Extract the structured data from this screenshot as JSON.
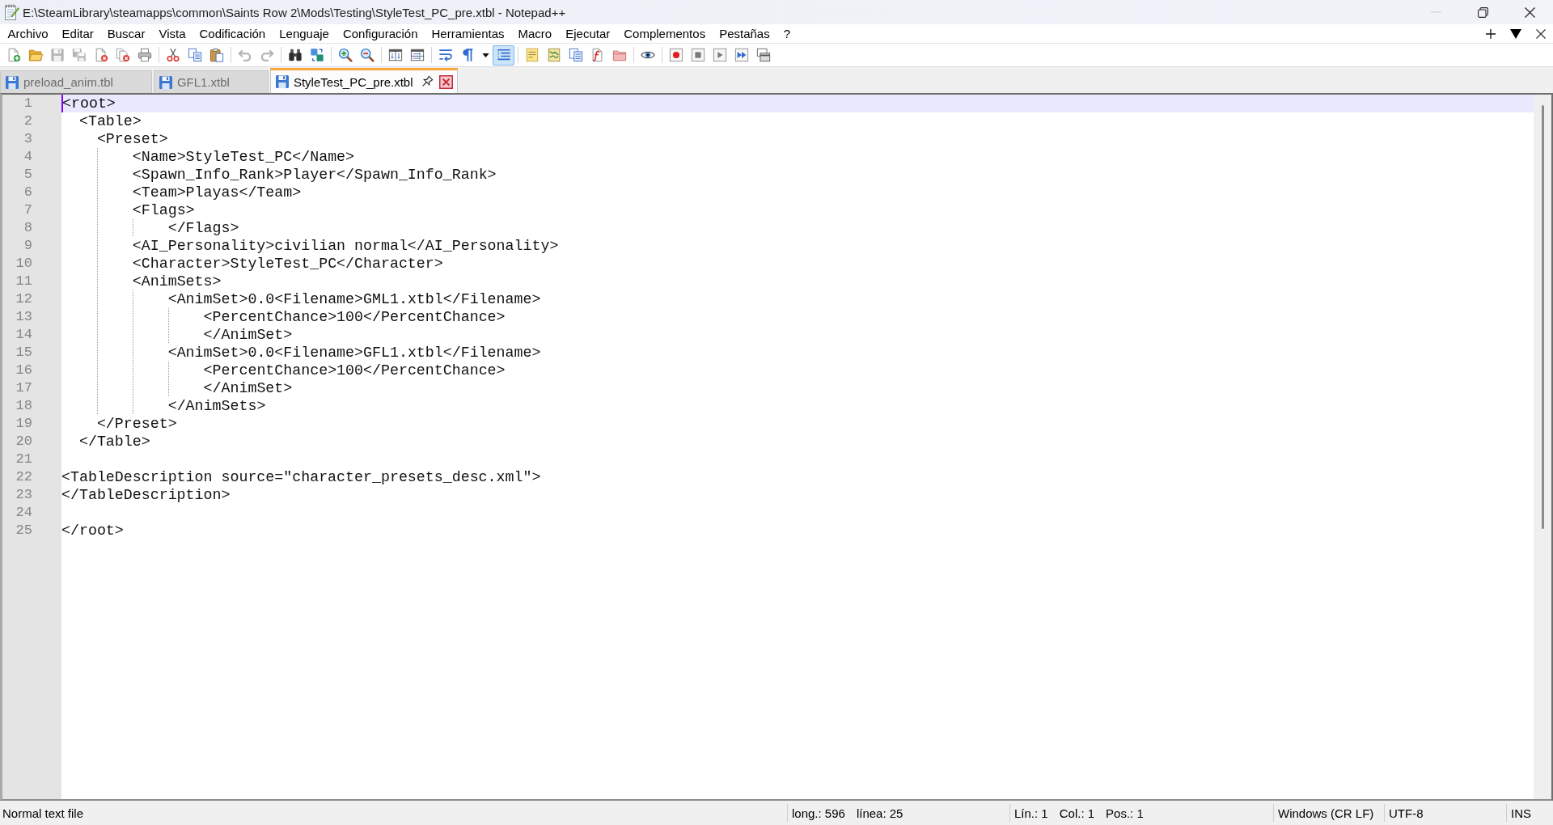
{
  "window": {
    "title": "E:\\SteamLibrary\\steamapps\\common\\Saints Row 2\\Mods\\Testing\\StyleTest_PC_pre.xtbl - Notepad++"
  },
  "menu": [
    "Archivo",
    "Editar",
    "Buscar",
    "Vista",
    "Codificación",
    "Lenguaje",
    "Configuración",
    "Herramientas",
    "Macro",
    "Ejecutar",
    "Complementos",
    "Pestañas",
    "?"
  ],
  "toolbar": {
    "groups": [
      [
        {
          "kind": "new",
          "on": false,
          "disabled": false
        },
        {
          "kind": "open",
          "on": false,
          "disabled": false
        },
        {
          "kind": "save",
          "on": false,
          "disabled": true
        },
        {
          "kind": "saveall",
          "on": false,
          "disabled": true
        },
        {
          "kind": "close",
          "on": false,
          "disabled": false
        },
        {
          "kind": "closeall",
          "on": false,
          "disabled": false
        },
        {
          "kind": "print",
          "on": false,
          "disabled": false
        }
      ],
      [
        {
          "kind": "cut",
          "on": false,
          "disabled": false
        },
        {
          "kind": "copy",
          "on": false,
          "disabled": false
        },
        {
          "kind": "paste",
          "on": false,
          "disabled": false
        }
      ],
      [
        {
          "kind": "undo",
          "on": false,
          "disabled": true
        },
        {
          "kind": "redo",
          "on": false,
          "disabled": true
        }
      ],
      [
        {
          "kind": "find",
          "on": false,
          "disabled": false
        },
        {
          "kind": "replace",
          "on": false,
          "disabled": false
        }
      ],
      [
        {
          "kind": "zoomin",
          "on": false,
          "disabled": false
        },
        {
          "kind": "zoomout",
          "on": false,
          "disabled": false
        }
      ],
      [
        {
          "kind": "syncv",
          "on": false,
          "disabled": false
        },
        {
          "kind": "synch",
          "on": false,
          "disabled": false
        }
      ],
      [
        {
          "kind": "wrap",
          "on": false,
          "disabled": false
        },
        {
          "kind": "pilcrow",
          "on": false,
          "disabled": false
        },
        {
          "kind": "dropdown",
          "on": false,
          "disabled": false
        },
        {
          "kind": "guides",
          "on": true,
          "disabled": false
        }
      ],
      [
        {
          "kind": "udl",
          "on": false,
          "disabled": false
        },
        {
          "kind": "docmap",
          "on": false,
          "disabled": false
        },
        {
          "kind": "doclist",
          "on": false,
          "disabled": false
        },
        {
          "kind": "funclist",
          "on": false,
          "disabled": false
        },
        {
          "kind": "workspace",
          "on": false,
          "disabled": false
        }
      ],
      [
        {
          "kind": "monitor",
          "on": false,
          "disabled": false
        }
      ],
      [
        {
          "kind": "record",
          "on": false,
          "disabled": false
        },
        {
          "kind": "stop",
          "on": false,
          "disabled": false
        },
        {
          "kind": "play",
          "on": false,
          "disabled": false
        },
        {
          "kind": "playmulti",
          "on": false,
          "disabled": false
        },
        {
          "kind": "savemacro",
          "on": false,
          "disabled": false
        }
      ]
    ]
  },
  "tabs": [
    {
      "label": "preload_anim.tbl",
      "selected": false
    },
    {
      "label": "GFL1.xtbl",
      "selected": false
    },
    {
      "label": "StyleTest_PC_pre.xtbl",
      "selected": true
    }
  ],
  "editor": {
    "lines": [
      {
        "number": "1",
        "text": "<root>",
        "current": true
      },
      {
        "number": "2",
        "text": "  <Table>",
        "current": false
      },
      {
        "number": "3",
        "text": "    <Preset>",
        "current": false
      },
      {
        "number": "4",
        "text": "        <Name>StyleTest_PC</Name>",
        "current": false
      },
      {
        "number": "5",
        "text": "        <Spawn_Info_Rank>Player</Spawn_Info_Rank>",
        "current": false
      },
      {
        "number": "6",
        "text": "        <Team>Playas</Team>",
        "current": false
      },
      {
        "number": "7",
        "text": "        <Flags>",
        "current": false
      },
      {
        "number": "8",
        "text": "            </Flags>",
        "current": false
      },
      {
        "number": "9",
        "text": "        <AI_Personality>civilian normal</AI_Personality>",
        "current": false
      },
      {
        "number": "10",
        "text": "        <Character>StyleTest_PC</Character>",
        "current": false
      },
      {
        "number": "11",
        "text": "        <AnimSets>",
        "current": false
      },
      {
        "number": "12",
        "text": "            <AnimSet>0.0<Filename>GML1.xtbl</Filename>",
        "current": false
      },
      {
        "number": "13",
        "text": "                <PercentChance>100</PercentChance>",
        "current": false
      },
      {
        "number": "14",
        "text": "                </AnimSet>",
        "current": false
      },
      {
        "number": "15",
        "text": "            <AnimSet>0.0<Filename>GFL1.xtbl</Filename>",
        "current": false
      },
      {
        "number": "16",
        "text": "                <PercentChance>100</PercentChance>",
        "current": false
      },
      {
        "number": "17",
        "text": "                </AnimSet>",
        "current": false
      },
      {
        "number": "18",
        "text": "            </AnimSets>",
        "current": false
      },
      {
        "number": "19",
        "text": "    </Preset>",
        "current": false
      },
      {
        "number": "20",
        "text": "  </Table>",
        "current": false
      },
      {
        "number": "21",
        "current": false
      },
      {
        "number": "22",
        "text": "<TableDescription source=\"character_presets_desc.xml\">",
        "current": false
      },
      {
        "number": "23",
        "text": "</TableDescription>",
        "current": false
      },
      {
        "number": "24",
        "current": false
      },
      {
        "number": "25",
        "text": "</root>",
        "current": false
      }
    ]
  },
  "status_bar": {
    "file_type": "Normal text file",
    "length": "long.: 596",
    "line_count": "línea: 25",
    "position": [
      "Lín.: 1",
      "Col.: 1",
      "Pos.: 1"
    ],
    "eol": "Windows (CR LF)",
    "encoding": "UTF-8",
    "mode": "INS"
  }
}
